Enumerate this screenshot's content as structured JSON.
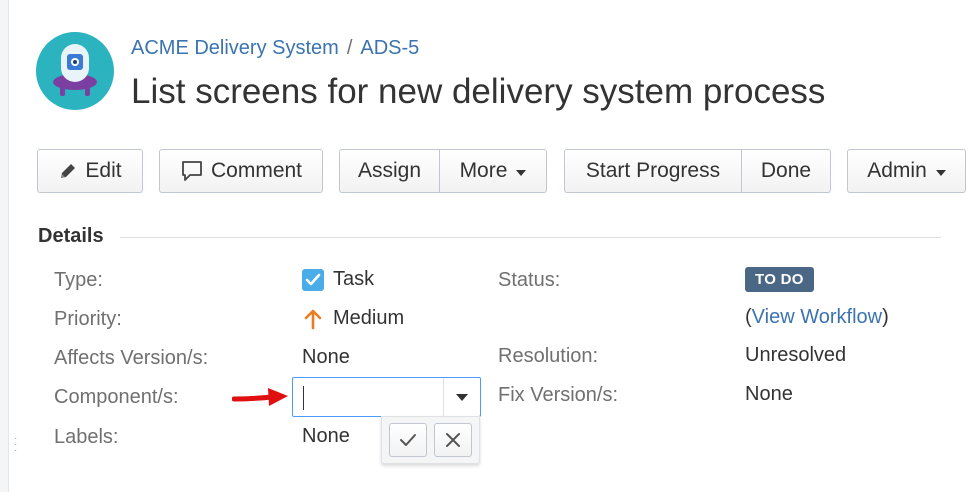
{
  "breadcrumb": {
    "project": "ACME Delivery System",
    "separator": "/",
    "issue_key": "ADS-5"
  },
  "issue": {
    "title": "List screens for new delivery system process"
  },
  "toolbar": {
    "edit": "Edit",
    "comment": "Comment",
    "assign": "Assign",
    "more": "More",
    "start_progress": "Start Progress",
    "done": "Done",
    "admin": "Admin"
  },
  "details": {
    "heading": "Details",
    "type_label": "Type:",
    "type_value": "Task",
    "priority_label": "Priority:",
    "priority_value": "Medium",
    "affects_label": "Affects Version/s:",
    "affects_value": "None",
    "component_label": "Component/s:",
    "component_value": "",
    "labels_label": "Labels:",
    "labels_value": "None",
    "status_label": "Status:",
    "status_value": "TO DO",
    "workflow_open": "(",
    "workflow_link": "View Workflow",
    "workflow_close": ")",
    "resolution_label": "Resolution:",
    "resolution_value": "Unresolved",
    "fix_label": "Fix Version/s:",
    "fix_value": "None"
  },
  "colors": {
    "link": "#3b73af",
    "status_lozenge": "#4a6785",
    "priority_medium": "#ea7d24",
    "task_icon": "#4bade8",
    "focus_border": "#4c9aff",
    "annotation_arrow": "#e01010",
    "avatar_bg": "#2bb3c0"
  },
  "icons": [
    "project-avatar-icon",
    "pencil-icon",
    "comment-icon",
    "task-checkbox-icon",
    "priority-medium-arrow-icon",
    "dropdown-caret-icon",
    "checkmark-icon",
    "close-icon",
    "annotation-arrow-icon"
  ]
}
